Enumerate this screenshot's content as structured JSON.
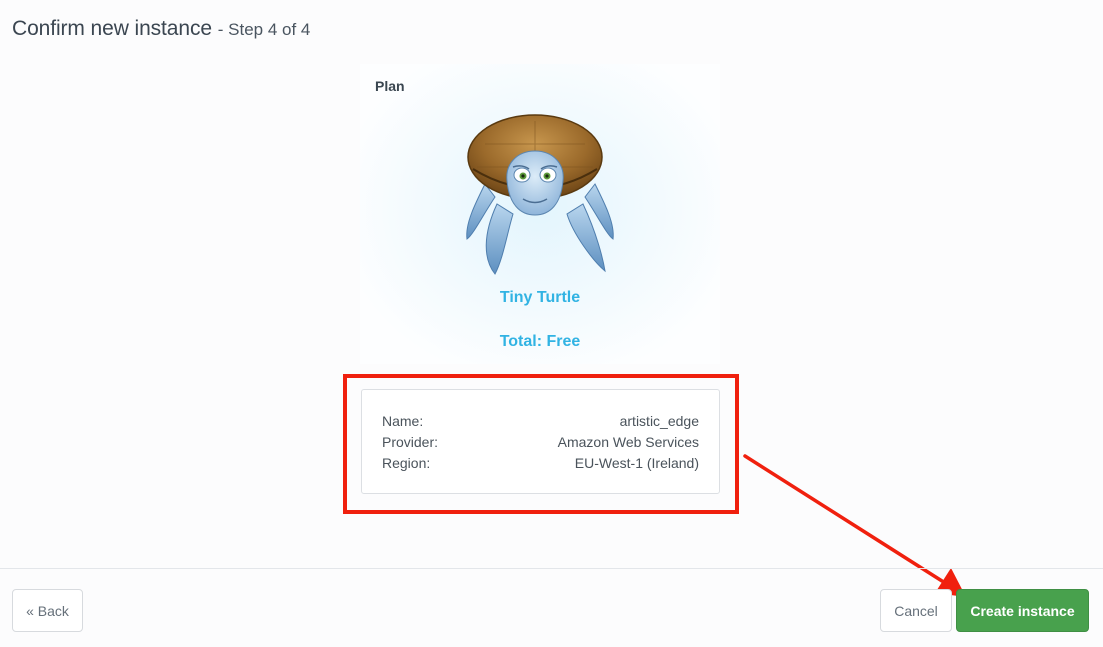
{
  "header": {
    "title": "Confirm new instance",
    "step": "- Step 4 of 4"
  },
  "plan": {
    "label": "Plan",
    "name": "Tiny Turtle",
    "total": "Total: Free",
    "image_icon": "turtle-illustration"
  },
  "details": [
    {
      "label": "Name:",
      "value": "artistic_edge"
    },
    {
      "label": "Provider:",
      "value": "Amazon Web Services"
    },
    {
      "label": "Region:",
      "value": "EU-West-1 (Ireland)"
    }
  ],
  "footer": {
    "back_label": "« Back",
    "cancel_label": "Cancel",
    "create_label": "Create instance"
  },
  "colors": {
    "accent_blue": "#31b3e3",
    "create_green": "#48a14d",
    "annotation_red": "#f0200e"
  }
}
